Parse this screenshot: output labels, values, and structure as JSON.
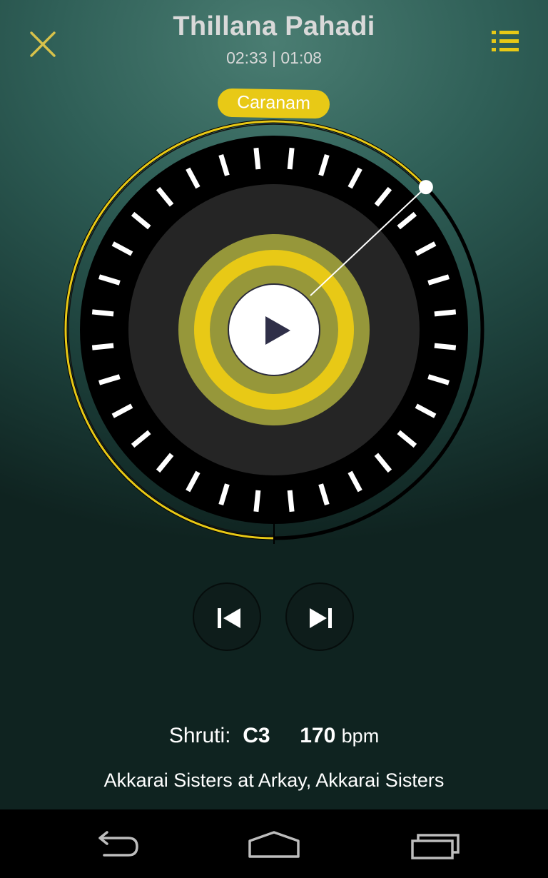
{
  "header": {
    "title": "Thillana Pahadi",
    "time_display": "02:33 | 01:08",
    "close_icon": "close-icon",
    "playlist_icon": "list-icon"
  },
  "dial": {
    "section_label": "Caranam",
    "progress": 0.125,
    "play_icon": "play-icon"
  },
  "controls": {
    "previous_icon": "skip-previous-icon",
    "next_icon": "skip-next-icon"
  },
  "info": {
    "shruti_label": "Shruti:",
    "shruti_value": "C3",
    "tempo_value": "170",
    "tempo_unit": "bpm",
    "artist_line": "Akkarai Sisters at Arkay, Akkarai Sisters"
  },
  "navbar": {
    "back_icon": "back-icon",
    "home_icon": "home-icon",
    "recents_icon": "recents-icon"
  },
  "colors": {
    "accent": "#e8c916",
    "accent_olive": "#96973a",
    "dial_black": "#000000",
    "dial_inner": "#252525"
  }
}
